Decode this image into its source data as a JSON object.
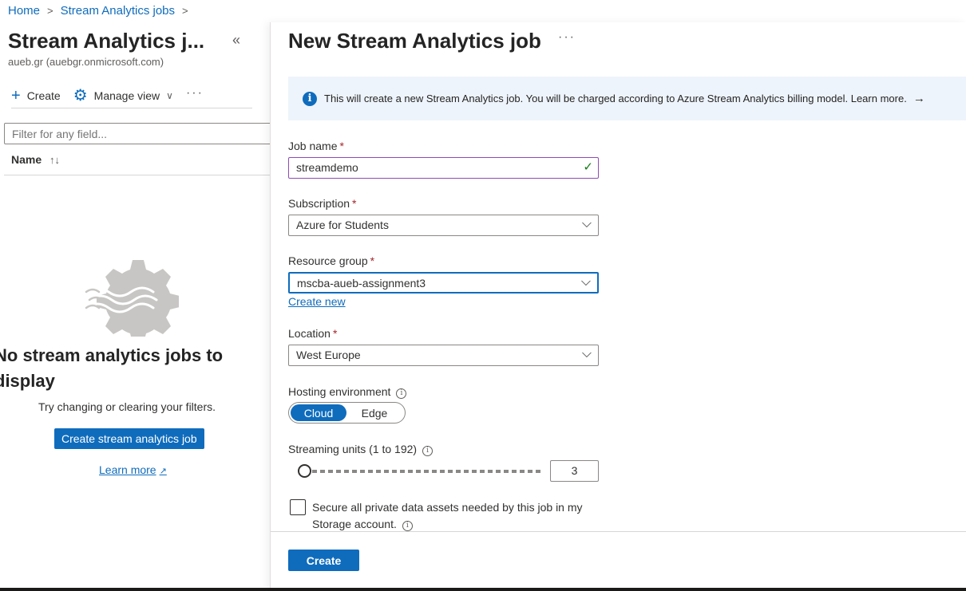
{
  "breadcrumb": {
    "home": "Home",
    "jobs": "Stream Analytics jobs"
  },
  "left": {
    "title": "Stream Analytics j...",
    "subtitle": "aueb.gr (auebgr.onmicrosoft.com)",
    "collapse": "«",
    "toolbar": {
      "create": "Create",
      "manage_view": "Manage view",
      "more": "···"
    },
    "filter_placeholder": "Filter for any field...",
    "column_name": "Name",
    "sort_icon": "↑↓",
    "empty_title": "No stream analytics jobs to display",
    "empty_subtitle": "Try changing or clearing your filters.",
    "create_button": "Create stream analytics job",
    "learn_more": "Learn more"
  },
  "right": {
    "title": "New Stream Analytics job",
    "more": "···",
    "info_text": "This will create a new Stream Analytics job. You will be charged according to Azure Stream Analytics billing model. Learn more.",
    "fields": {
      "job_name": {
        "label": "Job name",
        "value": "streamdemo"
      },
      "subscription": {
        "label": "Subscription",
        "value": "Azure for Students"
      },
      "resource_group": {
        "label": "Resource group",
        "value": "mscba-aueb-assignment3",
        "create_new": "Create new"
      },
      "location": {
        "label": "Location",
        "value": "West Europe"
      },
      "hosting": {
        "label": "Hosting environment",
        "options": [
          "Cloud",
          "Edge"
        ],
        "selected": "Cloud"
      },
      "streaming_units": {
        "label": "Streaming units (1 to 192)",
        "value": "3",
        "min": 1,
        "max": 192
      },
      "secure": {
        "label": "Secure all private data assets needed by this job in my Storage account.",
        "checked": false
      }
    },
    "create_button": "Create"
  },
  "colors": {
    "accent": "#0f6cbd",
    "required": "#a4262c",
    "valid": "#107c10",
    "info_bg": "#eef4fb"
  }
}
